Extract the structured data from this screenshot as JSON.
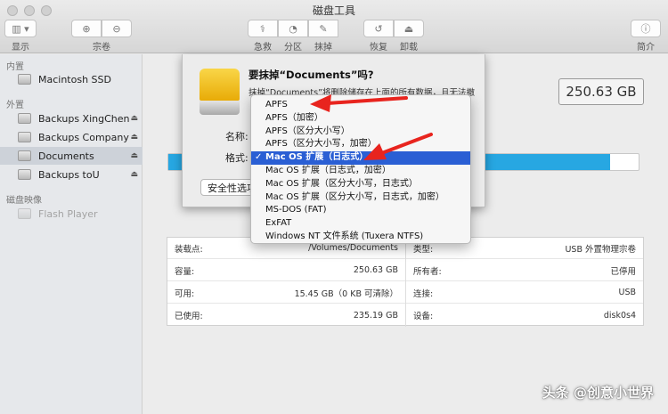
{
  "window": {
    "title": "磁盘工具"
  },
  "toolbar": {
    "display_label": "显示",
    "volume_label": "宗卷",
    "rescue_label": "急救",
    "partition_label": "分区",
    "erase_label": "抹掉",
    "restore_label": "恢复",
    "unmount_label": "卸载",
    "info_label": "简介"
  },
  "sidebar": {
    "internal_label": "内置",
    "internal_items": [
      {
        "label": "Macintosh SSD"
      }
    ],
    "external_label": "外置",
    "external_items": [
      {
        "label": "Backups XingChen"
      },
      {
        "label": "Backups Company"
      },
      {
        "label": "Documents"
      },
      {
        "label": "Backups toU"
      }
    ],
    "images_label": "磁盘映像",
    "image_items": [
      {
        "label": "Flash Player"
      }
    ]
  },
  "main": {
    "capacity": "250.63 GB",
    "usage_fraction": 0.94,
    "info_left": [
      {
        "key": "装载点:",
        "value": "/Volumes/Documents"
      },
      {
        "key": "容量:",
        "value": "250.63 GB"
      },
      {
        "key": "可用:",
        "value": "15.45 GB（0 KB 可清除）"
      },
      {
        "key": "已使用:",
        "value": "235.19 GB"
      }
    ],
    "info_right": [
      {
        "key": "类型:",
        "value": "USB 外置物理宗卷"
      },
      {
        "key": "所有者:",
        "value": "已停用"
      },
      {
        "key": "连接:",
        "value": "USB"
      },
      {
        "key": "设备:",
        "value": "disk0s4"
      }
    ]
  },
  "sheet": {
    "title": "要抹掉“Documents”吗?",
    "description": "抹掉“Documents”将删除储存在上面的所有数据，且无法撤",
    "name_label": "名称:",
    "format_label": "格式:",
    "security_button": "安全性选项"
  },
  "format_menu": {
    "options": [
      "APFS",
      "APFS（加密）",
      "APFS（区分大小写）",
      "APFS（区分大小写，加密）",
      "Mac OS 扩展（日志式）",
      "Mac OS 扩展（日志式，加密）",
      "Mac OS 扩展（区分大小写，日志式）",
      "Mac OS 扩展（区分大小写，日志式，加密）",
      "MS-DOS (FAT)",
      "ExFAT",
      "Windows NT 文件系统 (Tuxera NTFS)"
    ],
    "selected_check": "✓"
  },
  "colors": {
    "accent": "#2a5fd4",
    "usage_bar": "#27a7e2",
    "annotation": "#e8241e",
    "drive_yellow": "#f2c021"
  },
  "watermark": "头条 @创意小世界"
}
